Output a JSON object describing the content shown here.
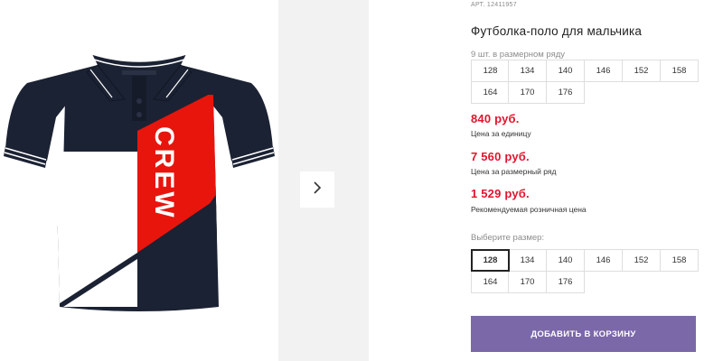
{
  "product": {
    "article": "АРТ. 12411957",
    "title": "Футболка-поло для мальчика",
    "colors": {
      "navy": "#1b2233",
      "red": "#e8150d",
      "white": "#ffffff",
      "accent": "#7b68a8",
      "price": "#e2142d"
    }
  },
  "gallery": {
    "next_icon": "chevron-right-icon"
  },
  "size_row": {
    "caption": "9 шт. в размерном ряду",
    "sizes": [
      "128",
      "134",
      "140",
      "146",
      "152",
      "158",
      "164",
      "170",
      "176"
    ]
  },
  "prices": {
    "unit_price": "840 руб.",
    "unit_label": "Цена за единицу",
    "row_price": "7 560 руб.",
    "row_label": "Цена за размерный ряд",
    "retail_price": "1 529 руб.",
    "retail_label": "Рекомендуемая розничная цена"
  },
  "size_select": {
    "label": "Выберите размер:",
    "selected": "128",
    "sizes": [
      "128",
      "134",
      "140",
      "146",
      "152",
      "158",
      "164",
      "170",
      "176"
    ]
  },
  "cart": {
    "add_label": "ДОБАВИТЬ В КОРЗИНУ"
  },
  "shirt_print": "CREW"
}
